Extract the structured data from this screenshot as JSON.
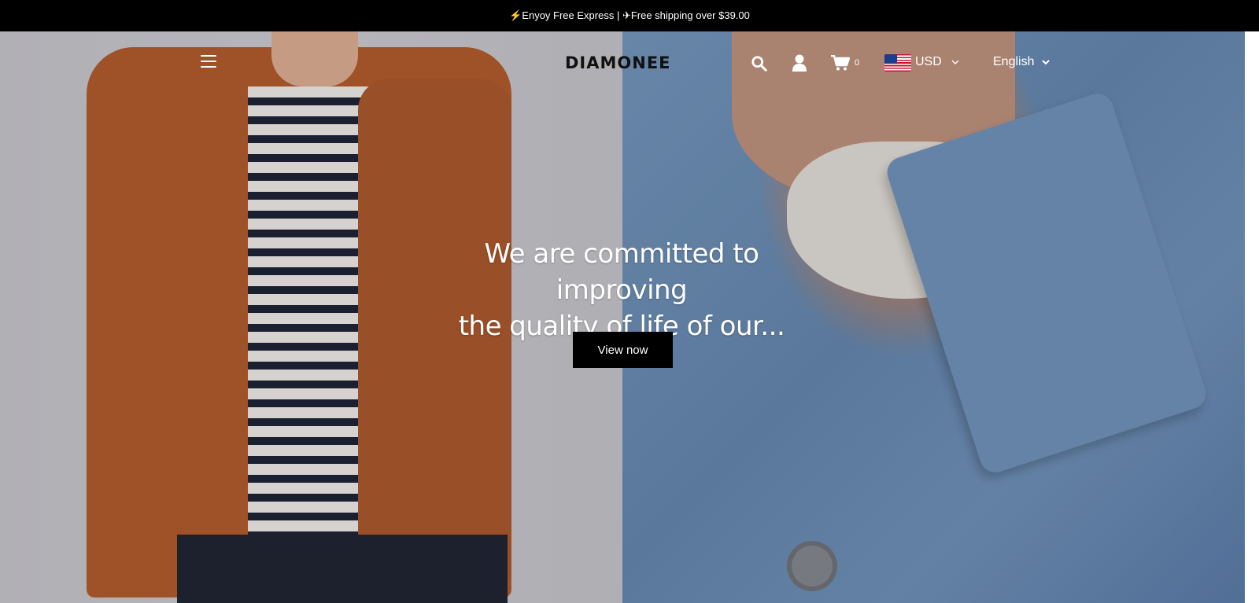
{
  "announcement": {
    "text": "⚡Enyoy Free Express | ✈Free shipping over $39.00"
  },
  "header": {
    "logo": "DIAMONEE",
    "cart_count": "0",
    "currency": "USD",
    "language": "English",
    "icons": [
      "menu-icon",
      "search-icon",
      "user-icon",
      "cart-icon",
      "us-flag-icon",
      "chevron-down-icon"
    ]
  },
  "hero": {
    "headline_line1": "We are committed to improving",
    "headline_line2": "the quality of life of our...",
    "cta_label": "View now"
  },
  "colors": {
    "topbar": "#000000",
    "cta_bg": "#000000",
    "text_light": "#ffffff"
  }
}
